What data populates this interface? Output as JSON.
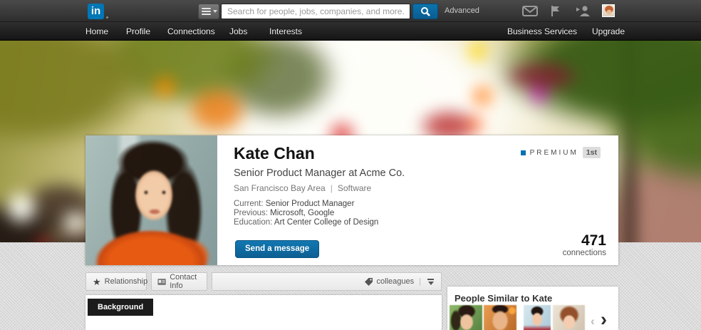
{
  "topbar": {
    "logo_text": "in",
    "search_placeholder": "Search for people, jobs, companies, and more...",
    "advanced_label": "Advanced"
  },
  "nav": {
    "items": [
      "Home",
      "Profile",
      "Connections",
      "Jobs",
      "Interests"
    ],
    "right_items": [
      "Business Services",
      "Upgrade"
    ]
  },
  "profile": {
    "name": "Kate Chan",
    "headline": "Senior Product Manager at Acme Co.",
    "location": "San Francisco Bay Area",
    "meta_divider": "|",
    "industry": "Software",
    "current_label": "Current:",
    "current_value": "Senior Product Manager",
    "previous_label": "Previous:",
    "previous_value": "Microsoft, Google",
    "education_label": "Education:",
    "education_value": "Art Center College of Design",
    "premium_label": "PREMIUM",
    "degree_badge": "1st",
    "send_message_label": "Send a message",
    "connections_count": "471",
    "connections_label": "connections"
  },
  "toolbar": {
    "relationship_label": "Relationship",
    "contact_info_label": "Contact Info",
    "tag_label": "colleagues",
    "tag_divider": "|"
  },
  "sections": {
    "background_label": "Background"
  },
  "similar_people": {
    "title": "People Similar to Kate"
  },
  "glyphs": {
    "star": "★",
    "chevron_left": "‹",
    "chevron_right": "›"
  },
  "colors": {
    "brand_blue": "#0077b5",
    "premium_blue": "#0073b0",
    "nav_black": "#1a1a1a",
    "page_gray": "#d9d9d9"
  }
}
